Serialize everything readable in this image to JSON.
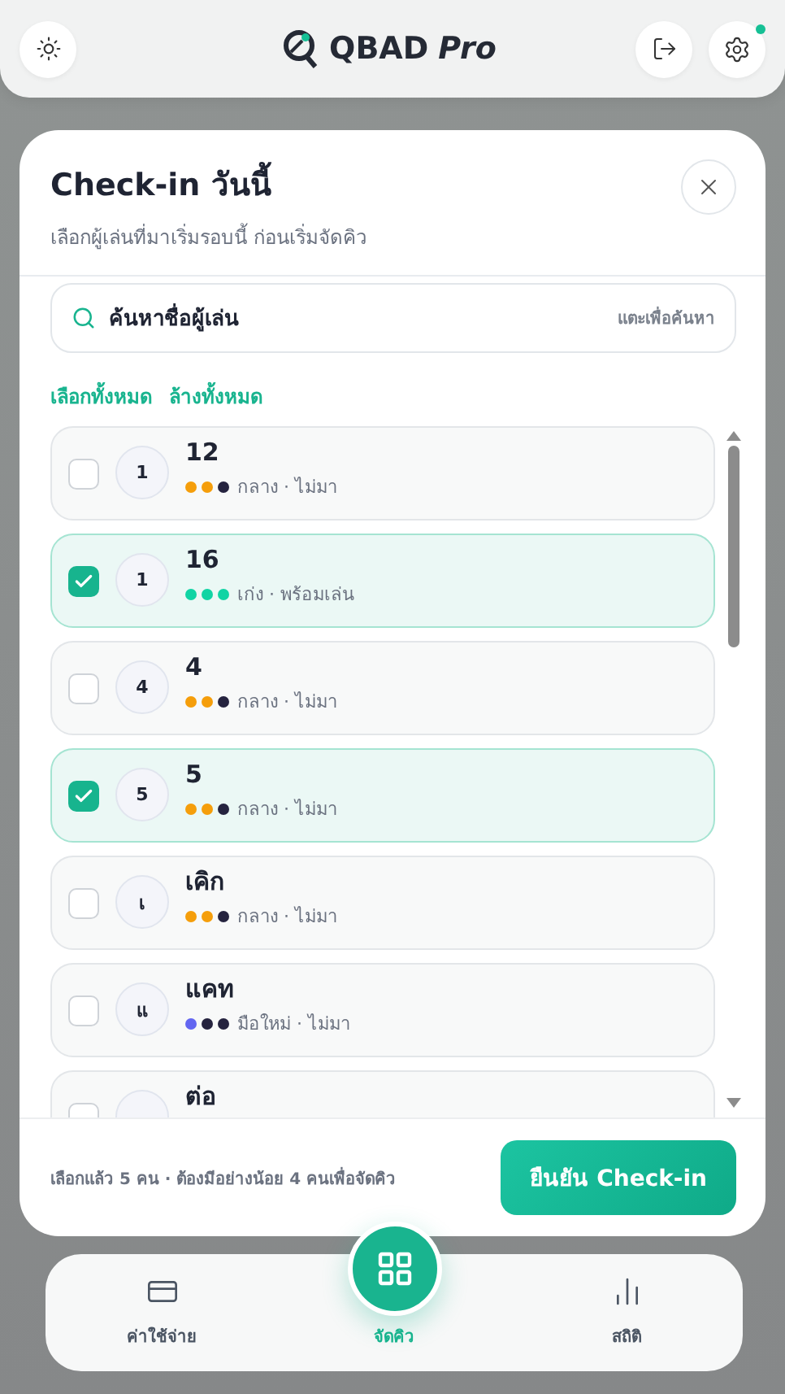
{
  "header": {
    "brand": "QBAD",
    "brand_suffix": "Pro",
    "settings_notice": true
  },
  "dialog": {
    "title": "Check-in วันนี้",
    "subtitle": "เลือกผู้เล่นที่มาเริ่มรอบนี้ ก่อนเริ่มจัดคิว",
    "search": {
      "value": "ค้นหาชื่อผู้เล่น",
      "hint": "แตะเพื่อค้นหา"
    },
    "actions": [
      "เลือกทั้งหมด",
      "ล้างทั้งหมด"
    ],
    "players": [
      {
        "name": "12",
        "avatar": "1",
        "checked": false,
        "dots": [
          {
            "color": "#f59e0b"
          },
          {
            "color": "#f59e0b"
          },
          {
            "color": "#25233f"
          }
        ],
        "info": "กลาง · ไม่มา"
      },
      {
        "name": "16",
        "avatar": "1",
        "checked": true,
        "dots": [
          {
            "color": "#10d4a4"
          },
          {
            "color": "#10d4a4"
          },
          {
            "color": "#10d4a4"
          }
        ],
        "info": "เก่ง · พร้อมเล่น"
      },
      {
        "name": "4",
        "avatar": "4",
        "checked": false,
        "dots": [
          {
            "color": "#f59e0b"
          },
          {
            "color": "#f59e0b"
          },
          {
            "color": "#25233f"
          }
        ],
        "info": "กลาง · ไม่มา"
      },
      {
        "name": "5",
        "avatar": "5",
        "checked": true,
        "dots": [
          {
            "color": "#f59e0b"
          },
          {
            "color": "#f59e0b"
          },
          {
            "color": "#25233f"
          }
        ],
        "info": "กลาง · ไม่มา"
      },
      {
        "name": "เคิก",
        "avatar": "เ",
        "checked": false,
        "dots": [
          {
            "color": "#f59e0b"
          },
          {
            "color": "#f59e0b"
          },
          {
            "color": "#25233f"
          }
        ],
        "info": "กลาง · ไม่มา"
      },
      {
        "name": "แคท",
        "avatar": "แ",
        "checked": false,
        "dots": [
          {
            "color": "#6366f1"
          },
          {
            "color": "#25233f"
          },
          {
            "color": "#25233f"
          }
        ],
        "info": "มือใหม่ · ไม่มา"
      },
      {
        "name": "ต่อ",
        "checked": false
      }
    ],
    "footer_note": "เลือกแล้ว 5 คน · ต้องมีอย่างน้อย 4 คนเพื่อจัดคิว",
    "confirm": "ยืนยัน Check-in"
  },
  "nav": [
    {
      "label": "ค่าใช้จ่าย",
      "kind": "wallet",
      "selected": false
    },
    {
      "label": "จัดคิว",
      "kind": "grid",
      "selected": true
    },
    {
      "label": "สถิติ",
      "kind": "chart",
      "selected": false
    }
  ]
}
